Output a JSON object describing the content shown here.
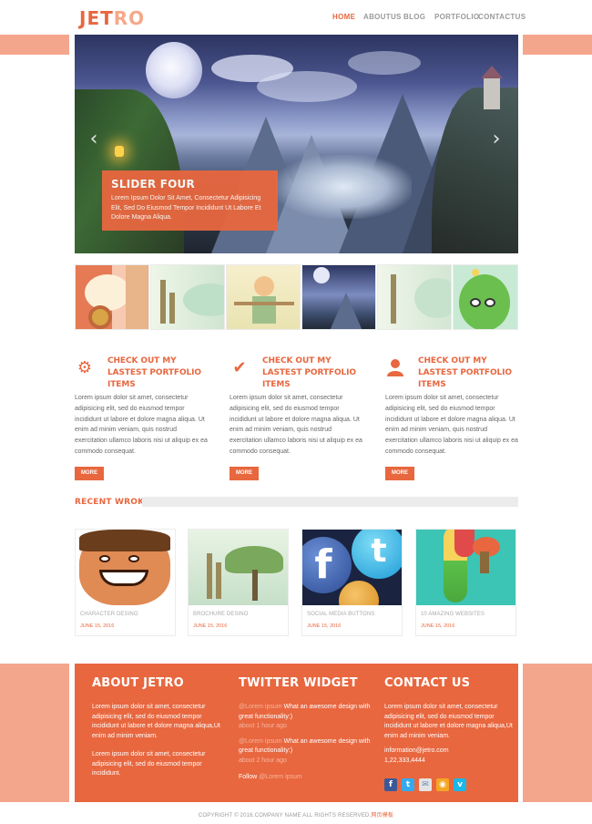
{
  "header": {
    "logo_main": "JET",
    "logo_accent": "RO",
    "nav": [
      {
        "label": "HOME",
        "active": true
      },
      {
        "label": "ABOUTUS",
        "active": false
      },
      {
        "label": "BLOG",
        "active": false
      },
      {
        "label": "PORTFOLIO",
        "active": false
      },
      {
        "label": "CONTACTUS",
        "active": false
      }
    ]
  },
  "slider": {
    "caption_title": "SLIDER FOUR",
    "caption_text": "Lorem Ipsum Dolor Sit Amet, Consectetur Adipisicing Elit, Sed Do Eiusmod Tempor Incididunt Ut Labore Et Dolore Magna Aliqua.",
    "prev_icon": "chevron-left-icon",
    "next_icon": "chevron-right-icon"
  },
  "features": [
    {
      "icon": "gear-icon",
      "title": "CHECK OUT MY LASTEST PORTFOLIO ITEMS",
      "text": "Lorem ipsum dolor sit amet, consectetur adipisicing elit, sed do eiusmod tempor incididunt ut labore et dolore magna aliqua. Ut enim ad minim veniam, quis nostrud exercitation ullamco laboris nisi ut aliquip ex ea commodo consequat.",
      "button": "MORE"
    },
    {
      "icon": "checkmark-icon",
      "title": "CHECK OUT MY LASTEST PORTFOLIO ITEMS",
      "text": "Lorem ipsum dolor sit amet, consectetur adipisicing elit, sed do eiusmod tempor incididunt ut labore et dolore magna aliqua. Ut enim ad minim veniam, quis nostrud exercitation ullamco laboris nisi ut aliquip ex ea commodo consequat.",
      "button": "MORE"
    },
    {
      "icon": "user-icon",
      "title": "CHECK OUT MY LASTEST PORTFOLIO ITEMS",
      "text": "Lorem ipsum dolor sit amet, consectetur adipisicing elit, sed do eiusmod tempor incididunt ut labore et dolore magna aliqua. Ut enim ad minim veniam, quis nostrud exercitation ullamco laboris nisi ut aliquip ex ea commodo consequat.",
      "button": "MORE"
    }
  ],
  "recent_works": {
    "title": "RECENT WROKS",
    "items": [
      {
        "title": "CHARACTER DESINO",
        "date": "JUNE 15, 2016"
      },
      {
        "title": "BROCHURE DESINO",
        "date": "JUNE 15, 2016"
      },
      {
        "title": "SOCIAL MEDIA BUTTONS",
        "date": "JUNE 15, 2016"
      },
      {
        "title": "10 AMAZING WEBSITES",
        "date": "JUNE 15, 2016"
      }
    ]
  },
  "footer": {
    "about": {
      "title": "ABOUT JETRO",
      "p1": "Lorem ipsum dolor sit amet, consectetur adipisicing elit, sed do eiusmod tempor incididunt ut labore et dolore magna aliqua,Ut enim ad minim veniam.",
      "p2": "Lorem ipsum dolor sit amet, consectetur adipisicing elit, sed do eiusmod tempor incididunt."
    },
    "twitter": {
      "title": "TWITTER WIDGET",
      "tweets": [
        {
          "handle": "@Lorem ipsum",
          "text": " What an awesome design with great functionality:)",
          "ago": "about 1 hour ago"
        },
        {
          "handle": "@Lorem ipsum",
          "text": " What an awesome design with great functionality:)",
          "ago": "about 2 hour ago"
        }
      ],
      "follow_label": "Follow ",
      "follow_handle": "@Lorem ipsum"
    },
    "contact": {
      "title": "CONTACT US",
      "text": "Lorem ipsum dolor sit amet, consectetur adipisicing elit, sed do eiusmod tempor incididunt ut labore et dolore magna aliqua,Ut enim ad minim veniam.",
      "email": "information@jetro.com",
      "phone": "1,22,333,4444",
      "socials": [
        {
          "icon": "facebook-icon",
          "glyph": "f",
          "color": "#3b5998"
        },
        {
          "icon": "twitter-icon",
          "glyph": "t",
          "color": "#33aaf0"
        },
        {
          "icon": "mail-icon",
          "glyph": "✉",
          "color": "#e4e4e4"
        },
        {
          "icon": "rss-icon",
          "glyph": "◉",
          "color": "#f5a623"
        },
        {
          "icon": "vimeo-icon",
          "glyph": "v",
          "color": "#1ab7ea"
        }
      ]
    }
  },
  "copyright": {
    "text": "COPYRIGHT © 2016.COMPANY NAME ALL RIGHTS RESERVED.",
    "brand": "网页模板"
  },
  "colors": {
    "accent": "#e8673f",
    "accent_light": "#f4a68c"
  }
}
